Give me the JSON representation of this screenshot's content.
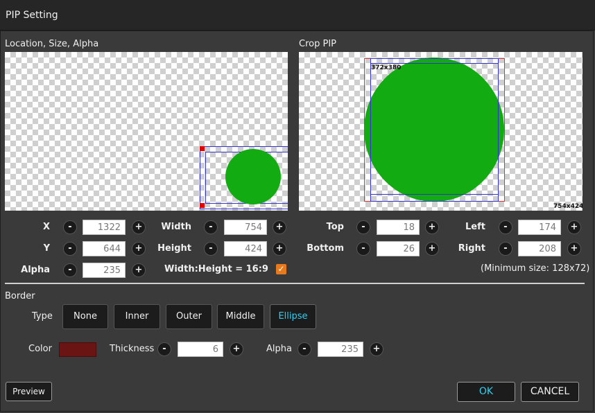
{
  "window": {
    "title": "PIP Setting"
  },
  "location_panel": {
    "label": "Location, Size, Alpha"
  },
  "crop_panel": {
    "label": "Crop PIP",
    "crop_size_label": "372x380",
    "source_size_label": "754x424"
  },
  "location": {
    "x": {
      "label": "X",
      "value": "1322"
    },
    "y": {
      "label": "Y",
      "value": "644"
    },
    "alpha": {
      "label": "Alpha",
      "value": "235"
    },
    "width": {
      "label": "Width",
      "value": "754"
    },
    "height": {
      "label": "Height",
      "value": "424"
    },
    "aspect_label": "Width:Height = 16:9",
    "aspect_checked": true
  },
  "crop": {
    "top": {
      "label": "Top",
      "value": "18"
    },
    "bottom": {
      "label": "Bottom",
      "value": "26"
    },
    "left": {
      "label": "Left",
      "value": "174"
    },
    "right": {
      "label": "Right",
      "value": "208"
    },
    "min_size": "(Minimum size: 128x72)"
  },
  "stepper": {
    "minus": "-",
    "plus": "+"
  },
  "border": {
    "label": "Border",
    "type_label": "Type",
    "types": [
      "None",
      "Inner",
      "Outer",
      "Middle",
      "Ellipse"
    ],
    "active_type": "Ellipse",
    "color_label": "Color",
    "color": "#6b1414",
    "thickness_label": "Thickness",
    "thickness": "6",
    "alpha_label": "Alpha",
    "alpha": "235"
  },
  "buttons": {
    "preview": "Preview",
    "ok": "OK",
    "cancel": "CANCEL"
  },
  "colors": {
    "accent": "#2ed0f0",
    "checkbox": "#e87a1e",
    "pip_green": "#12ab12"
  }
}
